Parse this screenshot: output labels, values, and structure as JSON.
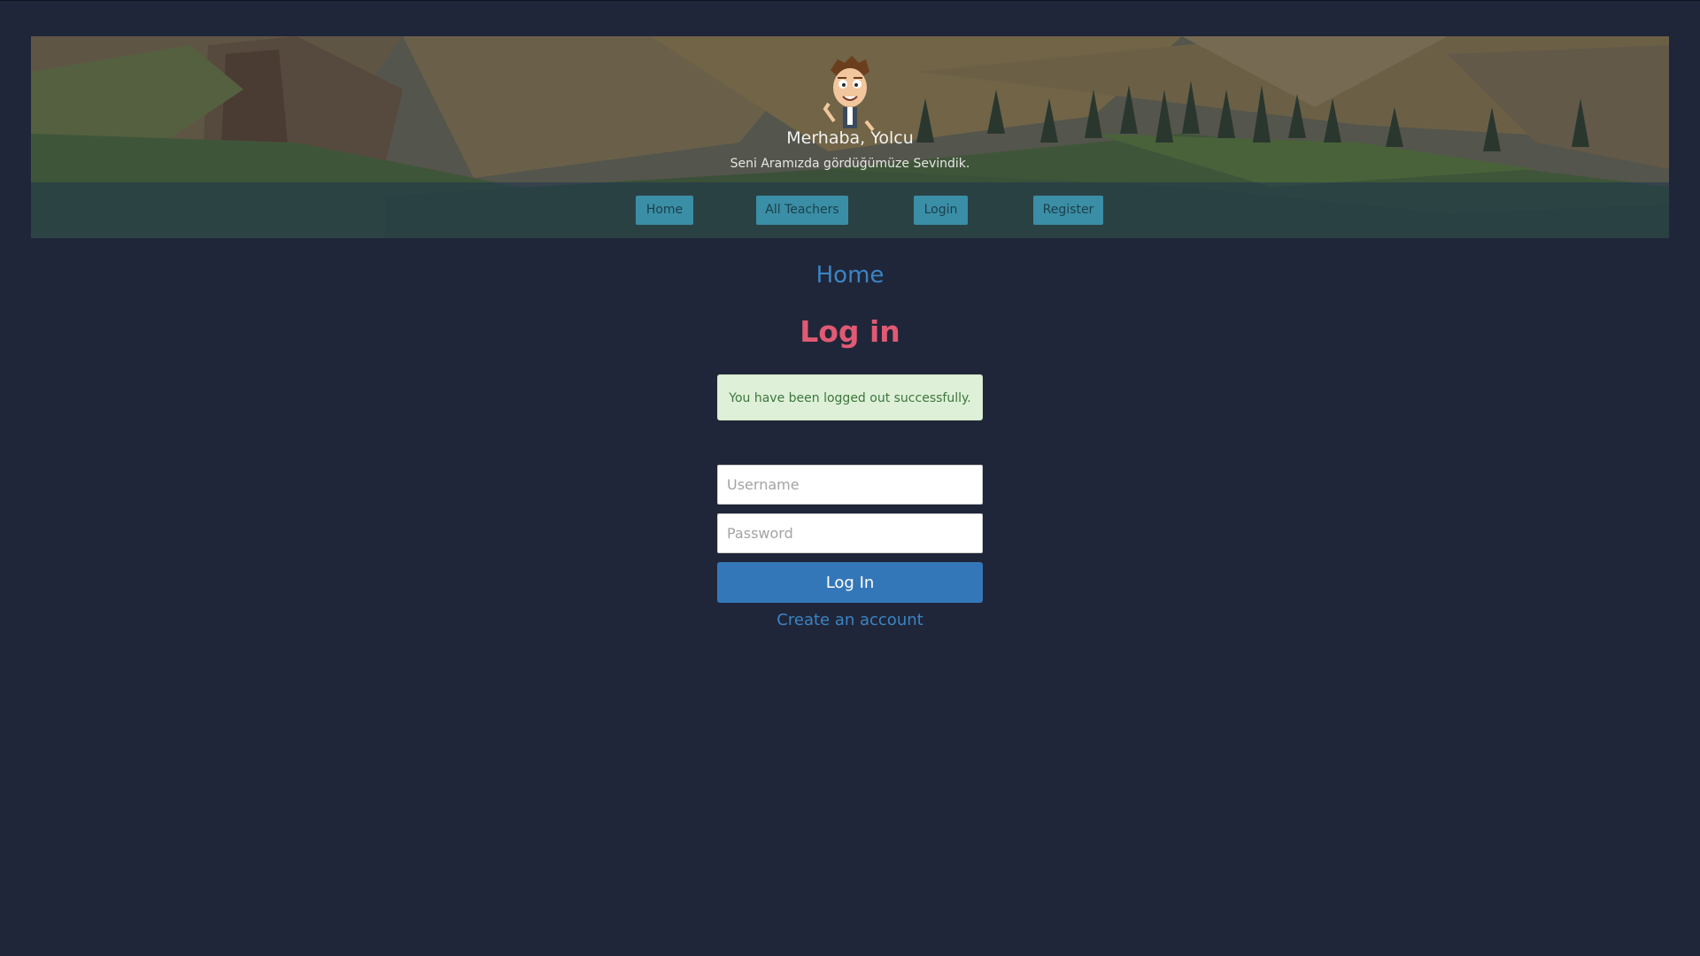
{
  "header": {
    "greeting": "Merhaba, Yolcu",
    "subtitle": "Seni Aramızda gördüğümüze Sevindik.",
    "avatar_icon": "waving-man-avatar"
  },
  "nav": {
    "items": [
      {
        "label": "Home"
      },
      {
        "label": "All Teachers"
      },
      {
        "label": "Login"
      },
      {
        "label": "Register"
      }
    ]
  },
  "main": {
    "home_link": "Home",
    "title": "Log in",
    "alert": "You have been logged out successfully.",
    "form": {
      "username_placeholder": "Username",
      "username_value": "",
      "password_placeholder": "Password",
      "password_value": "",
      "submit_label": "Log In"
    },
    "create_account": "Create an account"
  },
  "colors": {
    "background": "#202639",
    "nav_button": "#3a8ea6",
    "link": "#3a84c4",
    "title": "#e05a73",
    "alert_bg": "#dff0d8",
    "primary_button": "#3477b8"
  }
}
